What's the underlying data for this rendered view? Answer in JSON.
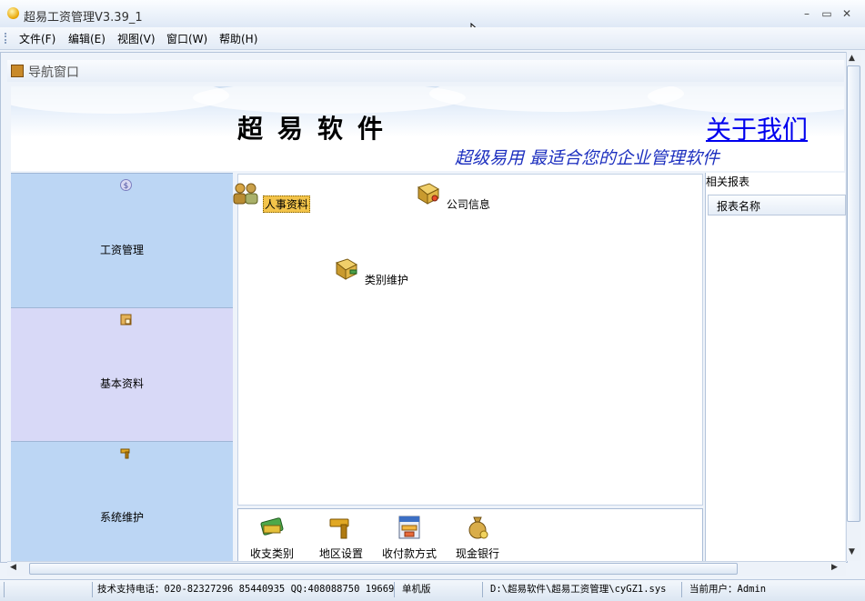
{
  "window": {
    "title": "超易工资管理V3.39_1",
    "controls": {
      "minimize": "–",
      "maximize": "▭",
      "close": "✕"
    }
  },
  "menu": [
    "文件(F)",
    "编辑(E)",
    "视图(V)",
    "窗口(W)",
    "帮助(H)"
  ],
  "nav": {
    "header": "导航窗口",
    "banner": {
      "title": "超易软件",
      "about": "关于我们",
      "slogan": "超级易用  最适合您的企业管理软件"
    },
    "categories": [
      {
        "label": "工资管理",
        "icon": "dollar-icon",
        "color": "#bcd6f4"
      },
      {
        "label": "基本资料",
        "icon": "folder-icon",
        "color": "#d8d9f7"
      },
      {
        "label": "系统维护",
        "icon": "hammer-icon",
        "color": "#bcd6f4"
      }
    ],
    "features": [
      {
        "label": "人事资料",
        "icon": "people-icon",
        "selected": true
      },
      {
        "label": "公司信息",
        "icon": "book-icon",
        "selected": false
      },
      {
        "label": "类别维护",
        "icon": "book-edit-icon",
        "selected": false
      }
    ],
    "tools": [
      {
        "label": "收支类别",
        "icon": "money-card-icon"
      },
      {
        "label": "地区设置",
        "icon": "hammer-icon"
      },
      {
        "label": "收付款方式",
        "icon": "payment-form-icon"
      },
      {
        "label": "现金银行",
        "icon": "money-bag-icon"
      }
    ]
  },
  "reports": {
    "title": "相关报表",
    "column": "报表名称"
  },
  "status": {
    "support": "技术支持电话：020-82327296 85440935 QQ:408088750 19669",
    "edition": "单机版",
    "path": "D:\\超易软件\\超易工资管理\\cyGZ1.sys",
    "user": "当前用户：Admin"
  }
}
